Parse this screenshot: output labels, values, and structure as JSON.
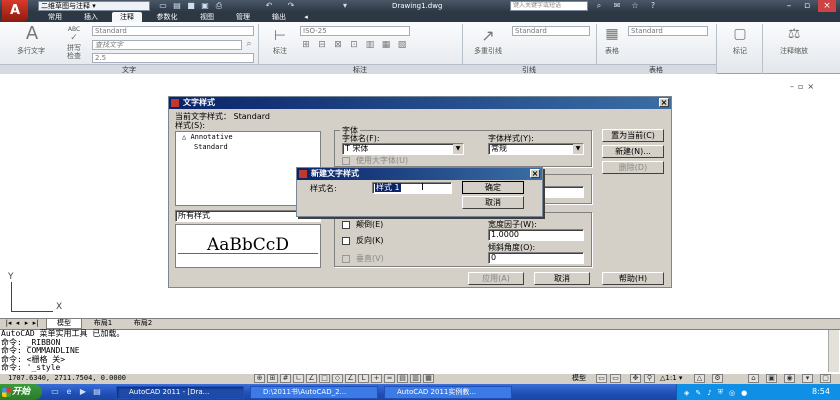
{
  "titlebar": {
    "workspace": "二维草图与注释",
    "document_title": "Drawing1.dwg",
    "search_placeholder": "键入关键字或短语"
  },
  "ribbon_tabs": [
    "常用",
    "插入",
    "注释",
    "参数化",
    "视图",
    "管理",
    "输出"
  ],
  "ribbon": {
    "text_panel": {
      "label": "文字",
      "mtext": "多行文字",
      "spell_top": "ABC",
      "spell": "拼写\n检查",
      "style_combo": "Standard",
      "find_placeholder": "查找文字",
      "height_combo": "2.5"
    },
    "dim_panel": {
      "label": "标注",
      "dim_button": "标注",
      "style_combo": "ISO-25"
    },
    "leader_panel": {
      "label": "引线",
      "multileader": "多重引线",
      "style_combo": "Standard"
    },
    "table_panel": {
      "label": "表格",
      "table_button": "表格",
      "style_combo": "Standard"
    },
    "mark_label": "标记",
    "annoscale_label": "注释缩放"
  },
  "text_style_dialog": {
    "title": "文字样式",
    "current_style_label": "当前文字样式：",
    "current_style_value": "Standard",
    "styles_label": "样式(S):",
    "styles": [
      "Annotative",
      "Standard"
    ],
    "filter_value": "所有样式",
    "preview_text": "AaBbCcD",
    "font_group": "字体",
    "font_name_label": "字体名(F):",
    "font_name_value": "宋体",
    "font_style_label": "字体样式(Y):",
    "font_style_value": "常规",
    "big_font_label": "使用大字体(U)",
    "upside_down_label": "颠倒(E)",
    "backwards_label": "反向(K)",
    "vertical_label": "垂直(V)",
    "width_factor_label": "宽度因子(W):",
    "width_factor_value": "1.0000",
    "oblique_label": "倾斜角度(O):",
    "oblique_value": "0",
    "set_current_btn": "置为当前(C)",
    "new_btn": "新建(N)...",
    "delete_btn": "删除(D)",
    "apply_btn": "应用(A)",
    "cancel_btn": "取消",
    "help_btn": "帮助(H)"
  },
  "new_style_dialog": {
    "title": "新建文字样式",
    "name_label": "样式名:",
    "name_value": "样式 1",
    "ok_btn": "确定",
    "cancel_btn": "取消"
  },
  "layout_tabs": [
    "模型",
    "布局1",
    "布局2"
  ],
  "command_history": [
    "AutoCAD 菜单实用工具 已加载。",
    "命令:  _RIBBON",
    "命令:  COMMANDLINE",
    "命令:  <栅格 关>",
    "命令:  '_style"
  ],
  "status": {
    "coordinates": "1707.6340, 2711.7504, 0.0000",
    "model_label": "模型",
    "scale_label": "1:1"
  },
  "taskbar": {
    "start_label": "开始",
    "tasks": [
      "AutoCAD 2011 - [Dra...",
      "D:\\2011书\\AutoCAD_2...",
      "AutoCAD 2011实例教..."
    ],
    "clock": "8:54"
  },
  "colors": {
    "title_dark": "#2d3845",
    "dialog_title": "#0a246a",
    "acad_red": "#c0392b",
    "taskbar_blue": "#245edb"
  }
}
